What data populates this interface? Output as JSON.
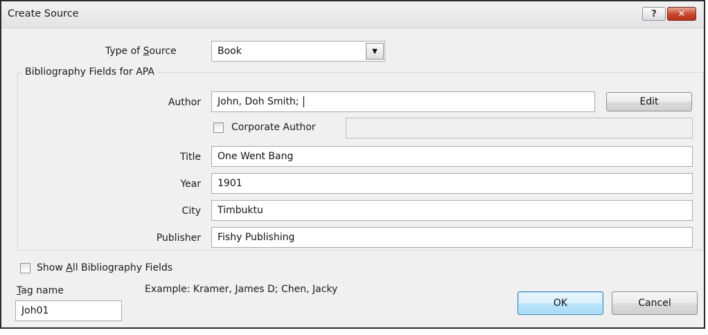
{
  "titlebar": {
    "title": "Create Source",
    "help_symbol": "?",
    "close_symbol": "✕"
  },
  "type_of_source": {
    "label_prefix": "Type of ",
    "label_accel": "S",
    "label_suffix": "ource",
    "value": "Book",
    "arrow": "▼"
  },
  "group": {
    "title": "Bibliography Fields for APA",
    "author": {
      "label": "Author",
      "value": "John, Doh Smith;"
    },
    "edit_button": "Edit",
    "corporate_author": {
      "label": "Corporate Author",
      "value": ""
    },
    "title_field": {
      "label": "Title",
      "value": "One Went Bang"
    },
    "year": {
      "label": "Year",
      "value": "1901"
    },
    "city": {
      "label": "City",
      "value": "Timbuktu"
    },
    "publisher": {
      "label": "Publisher",
      "value": "Fishy Publishing"
    }
  },
  "show_all": {
    "prefix": "Show ",
    "accel": "A",
    "suffix": "ll Bibliography Fields"
  },
  "tag_name": {
    "label_accel": "T",
    "label_rest": "ag name",
    "value": "Joh01"
  },
  "example": "Example: Kramer, James D; Chen, Jacky",
  "buttons": {
    "ok": "OK",
    "cancel": "Cancel"
  }
}
